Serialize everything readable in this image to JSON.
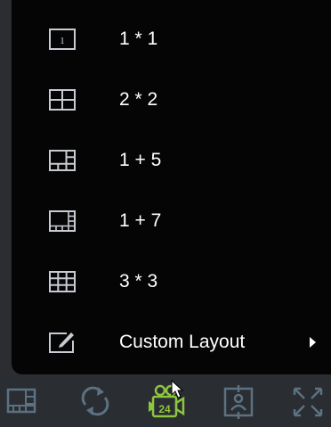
{
  "menu": {
    "items": [
      {
        "label": "1 * 1",
        "icon": "layout-1x1-icon",
        "icon_text": "1"
      },
      {
        "label": "2 * 2",
        "icon": "layout-2x2-icon"
      },
      {
        "label": "1 + 5",
        "icon": "layout-1plus5-icon"
      },
      {
        "label": "1 + 7",
        "icon": "layout-1plus7-icon"
      },
      {
        "label": "3 * 3",
        "icon": "layout-3x3-icon"
      },
      {
        "label": "Custom Layout",
        "icon": "custom-layout-edit-icon",
        "has_submenu": true
      }
    ]
  },
  "toolbar": {
    "buttons": [
      {
        "icon": "layout-icon"
      },
      {
        "icon": "cycle-icon"
      },
      {
        "icon": "camera-24-icon",
        "badge": "24"
      },
      {
        "icon": "target-frame-icon"
      },
      {
        "icon": "fullscreen-icon"
      }
    ]
  },
  "colors": {
    "menu_background": "#050505",
    "menu_text": "#ffffff",
    "icon_color": "#c8ccd2",
    "toolbar_background": "#2a2d31",
    "toolbar_icon": "#5c7182",
    "active_icon": "#8cc63e"
  }
}
